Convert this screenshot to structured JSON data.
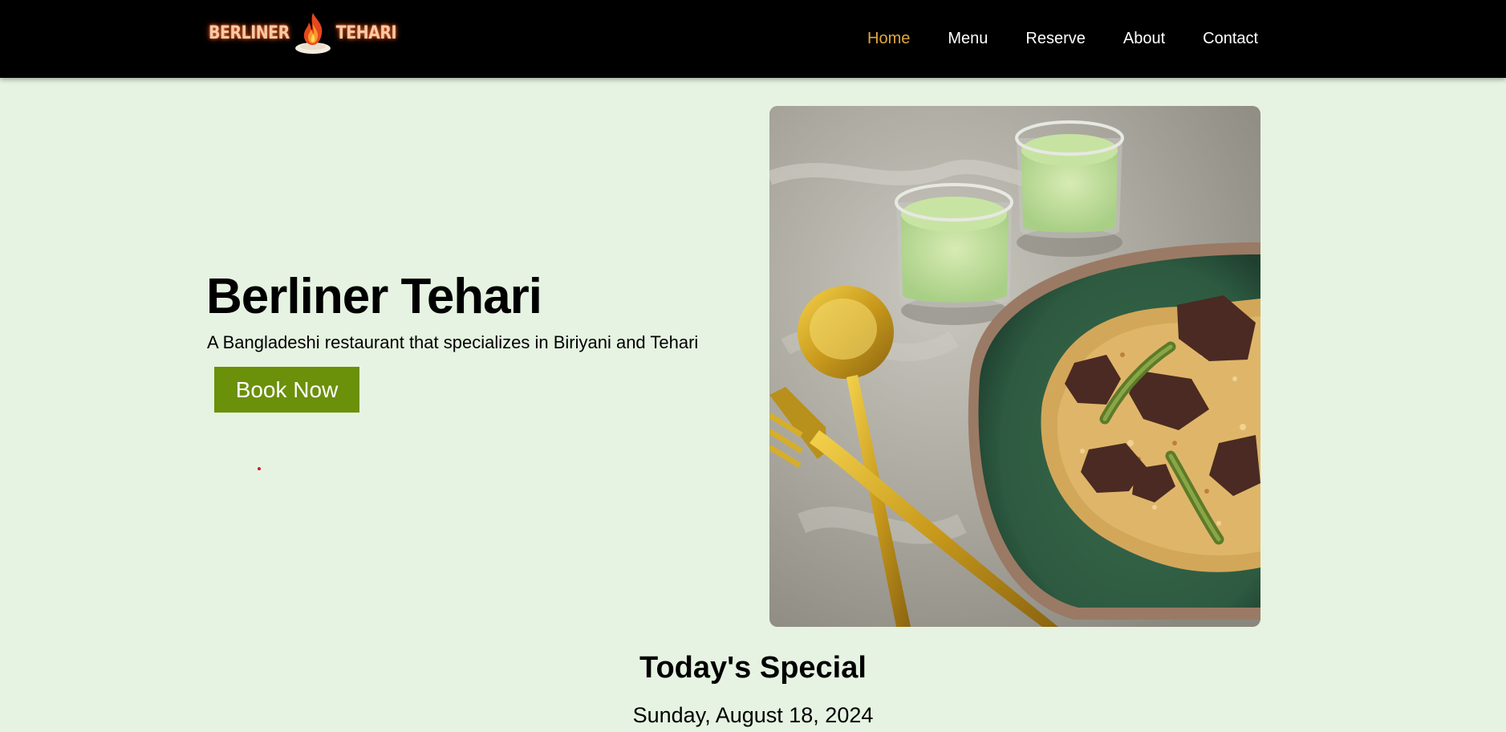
{
  "brand": {
    "logo_left": "BERLINER",
    "logo_right": "TEHARI",
    "logo_icon": "flame-plate-icon"
  },
  "nav": {
    "items": [
      {
        "label": "Home",
        "active": true
      },
      {
        "label": "Menu",
        "active": false
      },
      {
        "label": "Reserve",
        "active": false
      },
      {
        "label": "About",
        "active": false
      },
      {
        "label": "Contact",
        "active": false
      }
    ]
  },
  "hero": {
    "title": "Berliner Tehari",
    "subtitle": "A Bangladeshi restaurant that specializes in Biriyani and Tehari",
    "cta_label": "Book Now",
    "image": "tehari-plate-photo"
  },
  "special": {
    "heading": "Today's Special",
    "date": "Sunday, August 18, 2024"
  },
  "colors": {
    "background": "#e6f3e2",
    "navbar": "#000000",
    "nav_active": "#e1a740",
    "button": "#6b9009",
    "logo_text": "#f7c9a6"
  }
}
